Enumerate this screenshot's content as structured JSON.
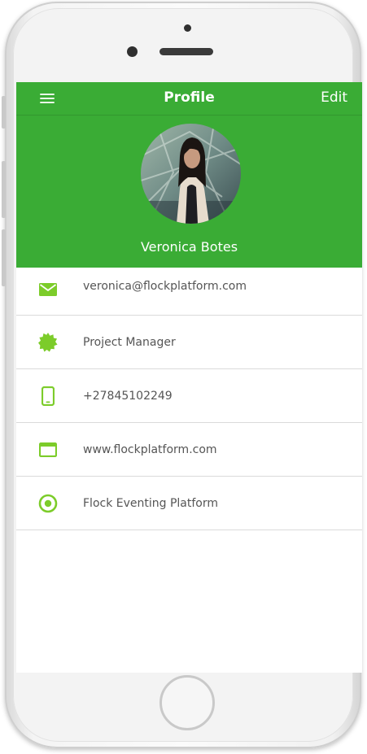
{
  "header": {
    "title": "Profile",
    "edit_label": "Edit",
    "menu_icon": "hamburger-menu-icon",
    "background_color": "#3aac35"
  },
  "profile": {
    "name": "Veronica Botes",
    "avatar": "profile-photo"
  },
  "details": [
    {
      "icon": "mail-icon",
      "text": "veronica@flockplatform.com"
    },
    {
      "icon": "badge-icon",
      "text": "Project Manager"
    },
    {
      "icon": "phone-icon",
      "text": "+27845102249"
    },
    {
      "icon": "browser-window-icon",
      "text": "www.flockplatform.com"
    },
    {
      "icon": "target-icon",
      "text": "Flock Eventing Platform"
    }
  ],
  "colors": {
    "accent_green": "#3aac35",
    "icon_green": "#7ccc2a",
    "text_gray": "#555555",
    "divider": "#dadada"
  }
}
